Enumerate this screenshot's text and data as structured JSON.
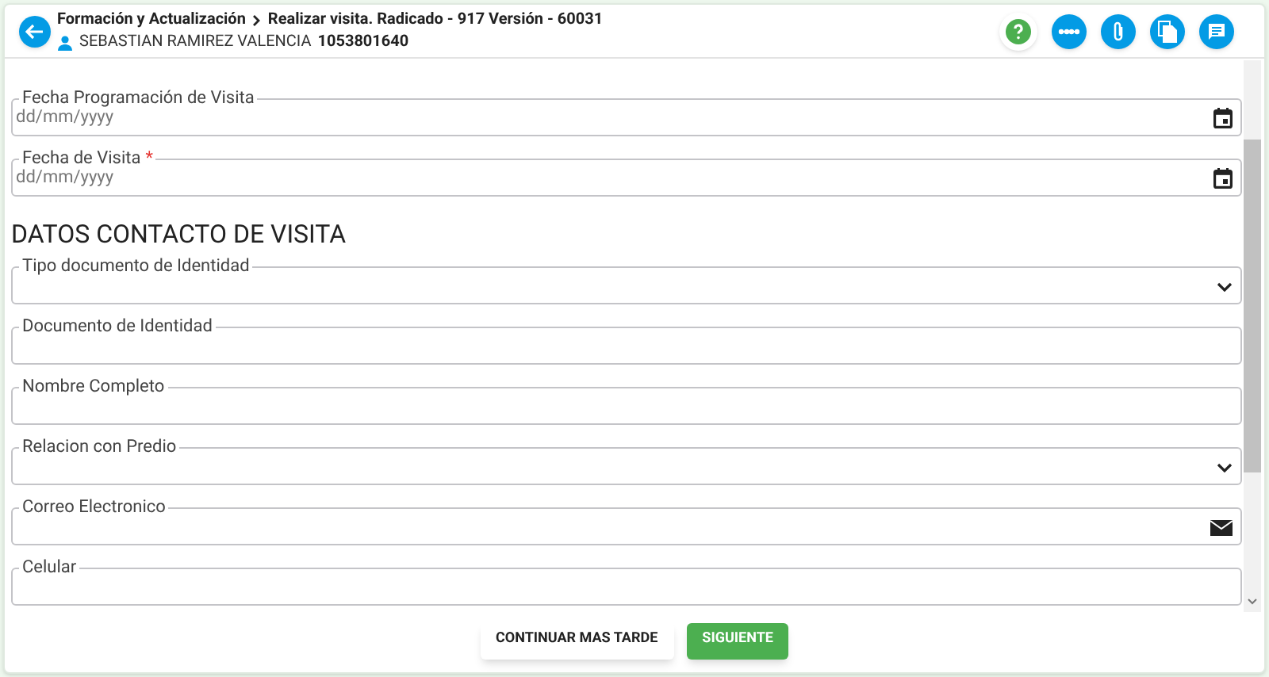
{
  "header": {
    "breadcrumb": [
      {
        "label": "Formación y Actualización"
      },
      {
        "label": "Realizar visita. Radicado - 917 Versión - 60031"
      }
    ],
    "user_name": "SEBASTIAN RAMIREZ VALENCIA",
    "user_id": "1053801640"
  },
  "toolbar": [
    {
      "kind": "help"
    },
    {
      "kind": "dots"
    },
    {
      "kind": "clip"
    },
    {
      "kind": "copy"
    },
    {
      "kind": "notes"
    }
  ],
  "form": [
    {
      "kind": "date",
      "label": "Fecha Programación de Visita",
      "required": false,
      "placeholder": "dd/mm/yyyy"
    },
    {
      "kind": "date",
      "label": "Fecha de Visita",
      "required": true,
      "required_mark": "*",
      "placeholder": "dd/mm/yyyy"
    },
    {
      "kind": "heading",
      "label": "DATOS CONTACTO DE VISITA"
    },
    {
      "kind": "select",
      "label": "Tipo documento de Identidad",
      "required": false
    },
    {
      "kind": "text",
      "label": "Documento de Identidad",
      "required": false
    },
    {
      "kind": "text",
      "label": "Nombre Completo",
      "required": false
    },
    {
      "kind": "select",
      "label": "Relacion con Predio",
      "required": false
    },
    {
      "kind": "email",
      "label": "Correo Electronico",
      "required": false
    },
    {
      "kind": "text",
      "label": "Celular",
      "required": false
    }
  ],
  "buttons": [
    {
      "kind": "secondary",
      "label": "CONTINUAR MAS TARDE"
    },
    {
      "kind": "primary",
      "label": "SIGUIENTE"
    }
  ]
}
